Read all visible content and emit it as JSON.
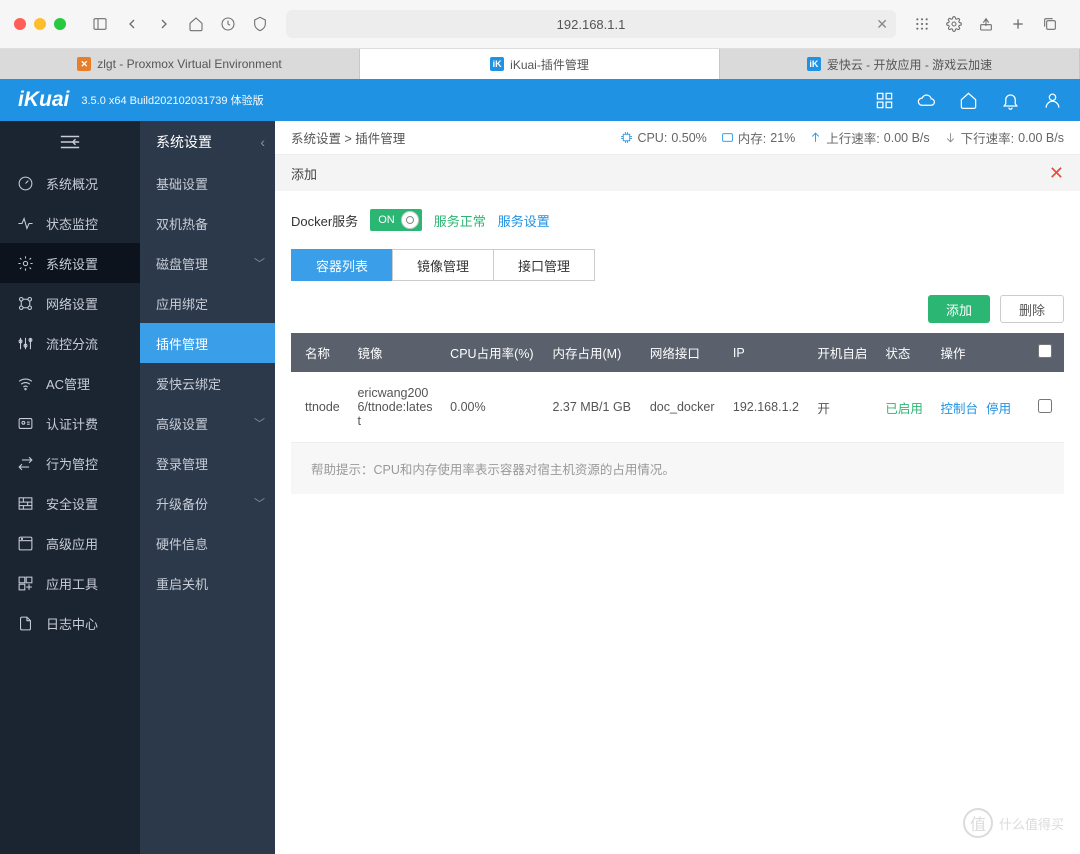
{
  "browser": {
    "url": "192.168.1.1",
    "tabs": [
      {
        "label": "zlgt - Proxmox Virtual Environment",
        "favicon_bg": "#e57f2c",
        "favicon_text": "✕"
      },
      {
        "label": "iKuai-插件管理",
        "favicon_bg": "#1f92e3",
        "favicon_text": "iK"
      },
      {
        "label": "爱快云 - 开放应用 - 游戏云加速",
        "favicon_bg": "#1f92e3",
        "favicon_text": "iK"
      }
    ]
  },
  "header": {
    "logo": "iKuai",
    "version": "3.5.0 x64 Build202102031739 体验版"
  },
  "sidebar1": [
    {
      "label": "系统概况",
      "icon": "dashboard"
    },
    {
      "label": "状态监控",
      "icon": "pulse"
    },
    {
      "label": "系统设置",
      "icon": "gear",
      "active": true
    },
    {
      "label": "网络设置",
      "icon": "network"
    },
    {
      "label": "流控分流",
      "icon": "sliders"
    },
    {
      "label": "AC管理",
      "icon": "wifi"
    },
    {
      "label": "认证计费",
      "icon": "card"
    },
    {
      "label": "行为管控",
      "icon": "swap"
    },
    {
      "label": "安全设置",
      "icon": "firewall"
    },
    {
      "label": "高级应用",
      "icon": "app"
    },
    {
      "label": "应用工具",
      "icon": "tools"
    },
    {
      "label": "日志中心",
      "icon": "log"
    }
  ],
  "sidebar2": {
    "title": "系统设置",
    "items": [
      {
        "label": "基础设置"
      },
      {
        "label": "双机热备"
      },
      {
        "label": "磁盘管理",
        "chev": true
      },
      {
        "label": "应用绑定"
      },
      {
        "label": "插件管理",
        "active": true
      },
      {
        "label": "爱快云绑定"
      },
      {
        "label": "高级设置",
        "chev": true
      },
      {
        "label": "登录管理"
      },
      {
        "label": "升级备份",
        "chev": true
      },
      {
        "label": "硬件信息"
      },
      {
        "label": "重启关机"
      }
    ]
  },
  "breadcrumb": {
    "a": "系统设置",
    "sep": " > ",
    "b": "插件管理"
  },
  "stats": {
    "cpu_label": "CPU:",
    "cpu_val": "0.50%",
    "mem_label": "内存:",
    "mem_val": "21%",
    "up_label": "上行速率:",
    "up_val": "0.00 B/s",
    "down_label": "下行速率:",
    "down_val": "0.00 B/s"
  },
  "panel": {
    "title": "添加"
  },
  "docker": {
    "label": "Docker服务",
    "toggle": "ON",
    "status": "服务正常",
    "settings": "服务设置"
  },
  "tabs": [
    {
      "label": "容器列表",
      "active": true
    },
    {
      "label": "镜像管理"
    },
    {
      "label": "接口管理"
    }
  ],
  "actions": {
    "add": "添加",
    "del": "删除"
  },
  "table": {
    "headers": [
      "名称",
      "镜像",
      "CPU占用率(%)",
      "内存占用(M)",
      "网络接口",
      "IP",
      "开机自启",
      "状态",
      "操作"
    ],
    "rows": [
      {
        "name": "ttnode",
        "image": "ericwang2006/ttnode:latest",
        "cpu": "0.00%",
        "mem": "2.37 MB/1 GB",
        "iface": "doc_docker",
        "ip": "192.168.1.2",
        "autostart": "开",
        "status": "已启用",
        "op1": "控制台",
        "op2": "停用"
      }
    ]
  },
  "hint": "帮助提示：CPU和内存使用率表示容器对宿主机资源的占用情况。",
  "watermark": "什么值得买"
}
